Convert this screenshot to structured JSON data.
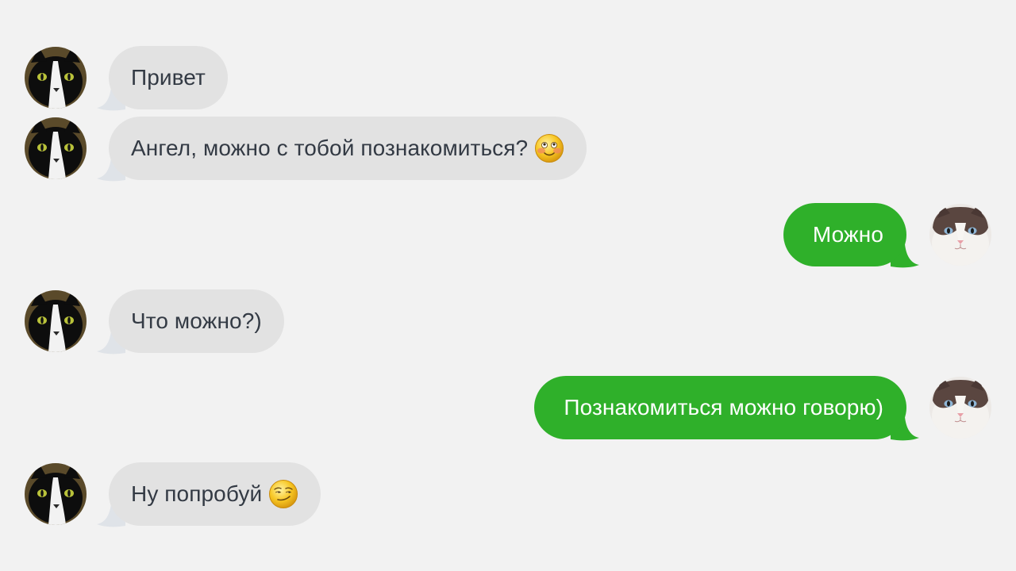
{
  "chat": {
    "messages": [
      {
        "direction": "incoming",
        "text": "Привет",
        "emoji": null
      },
      {
        "direction": "incoming",
        "text": "Ангел, можно с тобой познакомиться?",
        "emoji": "blushing-smile-emoji"
      },
      {
        "direction": "outgoing",
        "text": "Можно",
        "emoji": null
      },
      {
        "direction": "incoming",
        "text": "Что можно?)",
        "emoji": null
      },
      {
        "direction": "outgoing",
        "text": "Познакомиться можно говорю)",
        "emoji": null
      },
      {
        "direction": "incoming",
        "text": "Ну попробуй",
        "emoji": "smirk-emoji"
      }
    ],
    "avatars": {
      "incoming": "black-white-cat-avatar",
      "outgoing": "ragdoll-cat-avatar"
    }
  },
  "colors": {
    "background": "#f2f2f2",
    "incoming_bubble": "#e2e2e2",
    "incoming_text": "#333a44",
    "outgoing_bubble": "#2fb02a",
    "outgoing_text": "#ffffff"
  }
}
